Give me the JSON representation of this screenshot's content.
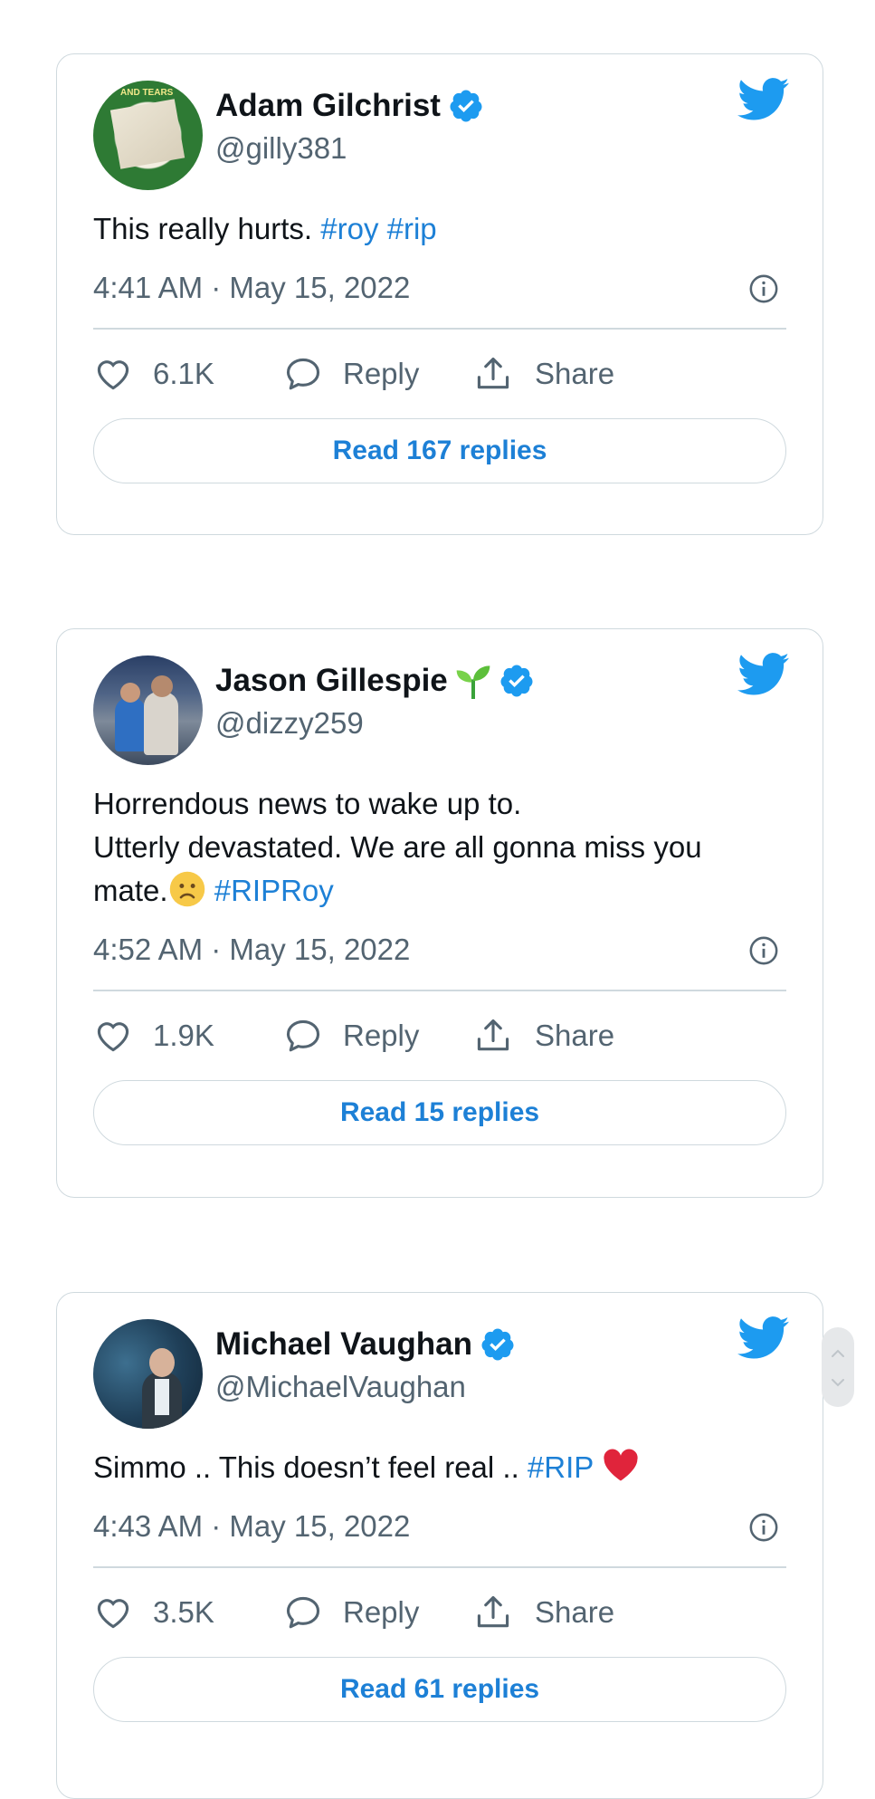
{
  "tweets": [
    {
      "name": "Adam Gilchrist",
      "handle": "@gilly381",
      "text": "This really hurts. ",
      "hashtags": [
        "#roy",
        "#rip"
      ],
      "time": "4:41 AM · May 15, 2022",
      "likes": "6.1K",
      "reply_label": "Reply",
      "share_label": "Share",
      "read_replies": "Read 167 replies",
      "avatar_text": "AND TEARS"
    },
    {
      "name": "Jason Gillespie",
      "handle": "@dizzy259",
      "text_line1": "Horrendous news to wake up to.",
      "text_line2": "Utterly devastated. We are all gonna miss you",
      "text_line3": "mate.",
      "hashtag": "#RIPRoy",
      "time": "4:52 AM · May 15, 2022",
      "likes": "1.9K",
      "reply_label": "Reply",
      "share_label": "Share",
      "read_replies": "Read 15 replies"
    },
    {
      "name": "Michael Vaughan",
      "handle": "@MichaelVaughan",
      "text": "Simmo .. This doesn’t feel real .. ",
      "hashtag": "#RIP",
      "time": "4:43 AM · May 15, 2022",
      "likes": "3.5K",
      "reply_label": "Reply",
      "share_label": "Share",
      "read_replies": "Read 61 replies"
    }
  ],
  "colors": {
    "link": "#1d80d6",
    "verified": "#1d9bf0",
    "twitter_bird": "#1d9bf0",
    "border": "#cfd9de",
    "secondary_text": "#536471"
  },
  "icons": [
    "twitter-bird-icon",
    "verified-badge-icon",
    "heart-icon",
    "reply-bubble-icon",
    "share-icon",
    "info-icon",
    "sprout-icon",
    "frown-emoji-icon",
    "red-heart-emoji-icon"
  ]
}
